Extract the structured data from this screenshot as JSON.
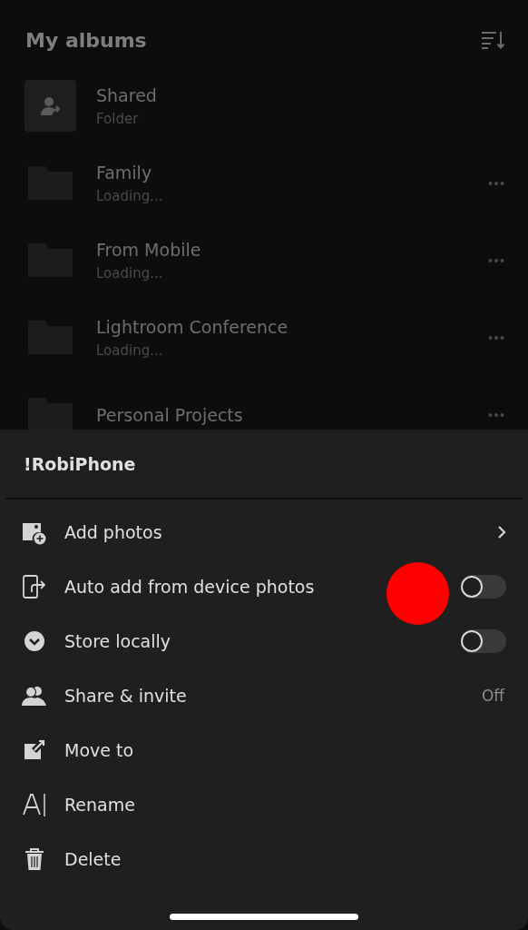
{
  "header": {
    "title": "My albums"
  },
  "albums": [
    {
      "kind": "shared",
      "name": "Shared",
      "subtitle": "Folder"
    },
    {
      "kind": "folder",
      "name": "Family",
      "subtitle": "Loading..."
    },
    {
      "kind": "folder",
      "name": "From Mobile",
      "subtitle": "Loading..."
    },
    {
      "kind": "folder",
      "name": "Lightroom Conference",
      "subtitle": "Loading..."
    },
    {
      "kind": "folder",
      "name": "Personal Projects"
    }
  ],
  "sheet": {
    "title": "!RobiPhone",
    "items": [
      {
        "kind": "chevron",
        "label": "Add photos"
      },
      {
        "kind": "toggle",
        "label": "Auto add from device photos",
        "on": false
      },
      {
        "kind": "toggle",
        "label": "Store locally",
        "on": false
      },
      {
        "kind": "value",
        "label": "Share & invite",
        "value": "Off"
      },
      {
        "kind": "plain",
        "label": "Move to"
      },
      {
        "kind": "plain",
        "label": "Rename"
      },
      {
        "kind": "plain",
        "label": "Delete"
      }
    ]
  }
}
